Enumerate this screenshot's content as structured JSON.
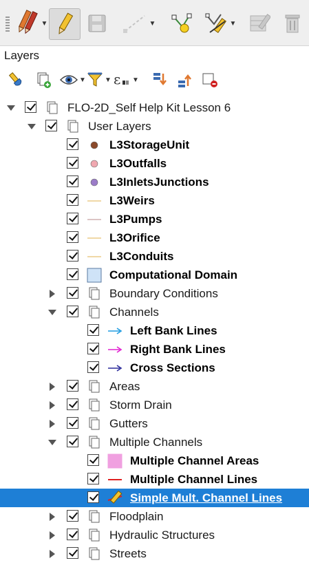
{
  "toolbar": {
    "items": [
      {
        "name": "digitize-tools-icon"
      },
      {
        "name": "toggle-editing-icon"
      },
      {
        "name": "save-edits-icon"
      },
      {
        "name": "add-feature-icon"
      },
      {
        "name": "vertex-tool-icon"
      },
      {
        "name": "modify-attributes-icon"
      },
      {
        "name": "edit-table-icon"
      },
      {
        "name": "delete-selected-icon"
      }
    ]
  },
  "panel": {
    "title": "Layers",
    "tools": [
      "style-manager-icon",
      "add-group-icon",
      "manage-visibility-icon",
      "filter-legend-icon",
      "filter-expression-icon",
      "expand-all-icon",
      "collapse-all-icon",
      "remove-layer-icon"
    ]
  },
  "colors": {
    "selection": "#1e7fd6",
    "storage_unit": "#8b4a2b",
    "outfalls": "#f0a8b0",
    "inlets": "#9b7cc8",
    "line_tan": "#e8c070",
    "line_pump": "#c8a0a0",
    "domain_fill": "#cfe3f7",
    "left_bank": "#1e9be0",
    "right_bank": "#e020d0",
    "cross_sections": "#2a2a9a",
    "mc_areas": "#f0a0e0",
    "mc_lines": "#e02020"
  },
  "tree": {
    "rows": [
      {
        "label": "FLO-2D_Self Help Kit Lesson 6",
        "level": 0,
        "kind": "group",
        "expanded": true,
        "bold": false
      },
      {
        "label": "User Layers",
        "level": 1,
        "kind": "group",
        "expanded": true,
        "bold": false
      },
      {
        "label": "L3StorageUnit",
        "level": 2,
        "kind": "point",
        "color": "#8b4a2b",
        "bold": true
      },
      {
        "label": "L3Outfalls",
        "level": 2,
        "kind": "point",
        "color": "#f0a8b0",
        "bold": true
      },
      {
        "label": "L3InletsJunctions",
        "level": 2,
        "kind": "point",
        "color": "#9b7cc8",
        "bold": true
      },
      {
        "label": "L3Weirs",
        "level": 2,
        "kind": "line",
        "color": "#e8c070",
        "bold": true
      },
      {
        "label": "L3Pumps",
        "level": 2,
        "kind": "line",
        "color": "#c8a0a0",
        "bold": true
      },
      {
        "label": "L3Orifice",
        "level": 2,
        "kind": "line",
        "color": "#e8c070",
        "bold": true
      },
      {
        "label": "L3Conduits",
        "level": 2,
        "kind": "line",
        "color": "#e8c070",
        "bold": true
      },
      {
        "label": "Computational Domain",
        "level": 2,
        "kind": "poly",
        "color": "#cfe3f7",
        "bold": true
      },
      {
        "label": "Boundary Conditions",
        "level": 2,
        "kind": "group",
        "expanded": false,
        "bold": false
      },
      {
        "label": "Channels",
        "level": 2,
        "kind": "group",
        "expanded": true,
        "bold": false
      },
      {
        "label": "Left Bank Lines",
        "level": 3,
        "kind": "arrow",
        "color": "#1e9be0",
        "bold": true
      },
      {
        "label": "Right Bank Lines",
        "level": 3,
        "kind": "arrow",
        "color": "#e020d0",
        "bold": true
      },
      {
        "label": "Cross Sections",
        "level": 3,
        "kind": "arrow",
        "color": "#2a2a9a",
        "bold": true
      },
      {
        "label": "Areas",
        "level": 2,
        "kind": "group",
        "expanded": false,
        "bold": false
      },
      {
        "label": "Storm Drain",
        "level": 2,
        "kind": "group",
        "expanded": false,
        "bold": false
      },
      {
        "label": "Gutters",
        "level": 2,
        "kind": "group",
        "expanded": false,
        "bold": false
      },
      {
        "label": "Multiple Channels",
        "level": 2,
        "kind": "group",
        "expanded": true,
        "bold": false
      },
      {
        "label": "Multiple Channel Areas",
        "level": 3,
        "kind": "poly",
        "color": "#f0a0e0",
        "bold": true
      },
      {
        "label": "Multiple Channel Lines",
        "level": 3,
        "kind": "line",
        "color": "#e02020",
        "bold": true
      },
      {
        "label": "Simple Mult. Channel Lines",
        "level": 3,
        "kind": "edit",
        "bold": true,
        "selected": true
      },
      {
        "label": "Floodplain",
        "level": 2,
        "kind": "group",
        "expanded": false,
        "bold": false
      },
      {
        "label": "Hydraulic Structures",
        "level": 2,
        "kind": "group",
        "expanded": false,
        "bold": false
      },
      {
        "label": "Streets",
        "level": 2,
        "kind": "group",
        "expanded": false,
        "bold": false
      }
    ]
  }
}
